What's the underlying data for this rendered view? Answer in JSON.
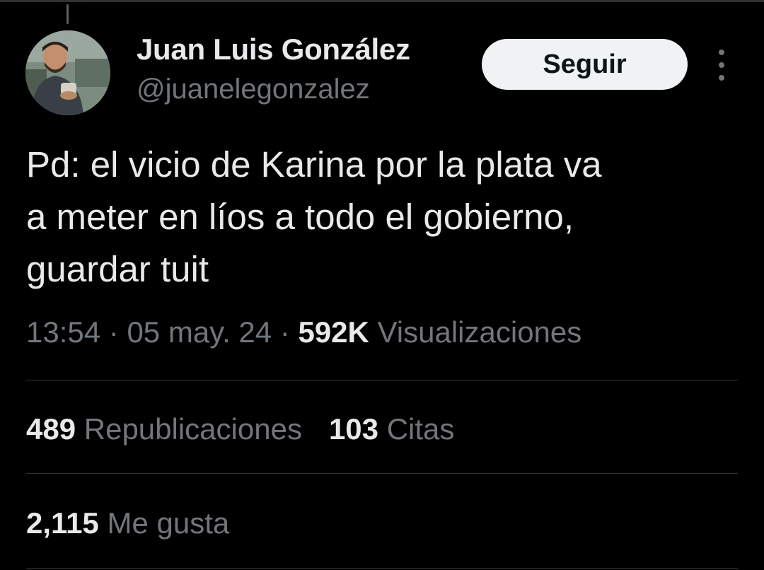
{
  "tweet": {
    "author": {
      "display_name": "Juan Luis González",
      "handle": "@juanelegonzalez"
    },
    "follow_label": "Seguir",
    "more_icon": "more-vertical-icon",
    "text_lines": [
      "Pd: el vicio de Karina por la plata va",
      "a meter en líos a todo el gobierno,",
      "guardar tuit"
    ],
    "time": "13:54",
    "separator": "·",
    "date": "05 may. 24",
    "views_count": "592K",
    "views_label": "Visualizaciones",
    "reposts_count": "489",
    "reposts_label": "Republicaciones",
    "quotes_count": "103",
    "quotes_label": "Citas",
    "likes_count": "2,115",
    "likes_label": "Me gusta"
  },
  "colors": {
    "background": "#000000",
    "primary_text": "#e7e9ea",
    "secondary_text": "#71767b",
    "divider": "#2f3336",
    "follow_button_bg": "#eff3f4"
  }
}
